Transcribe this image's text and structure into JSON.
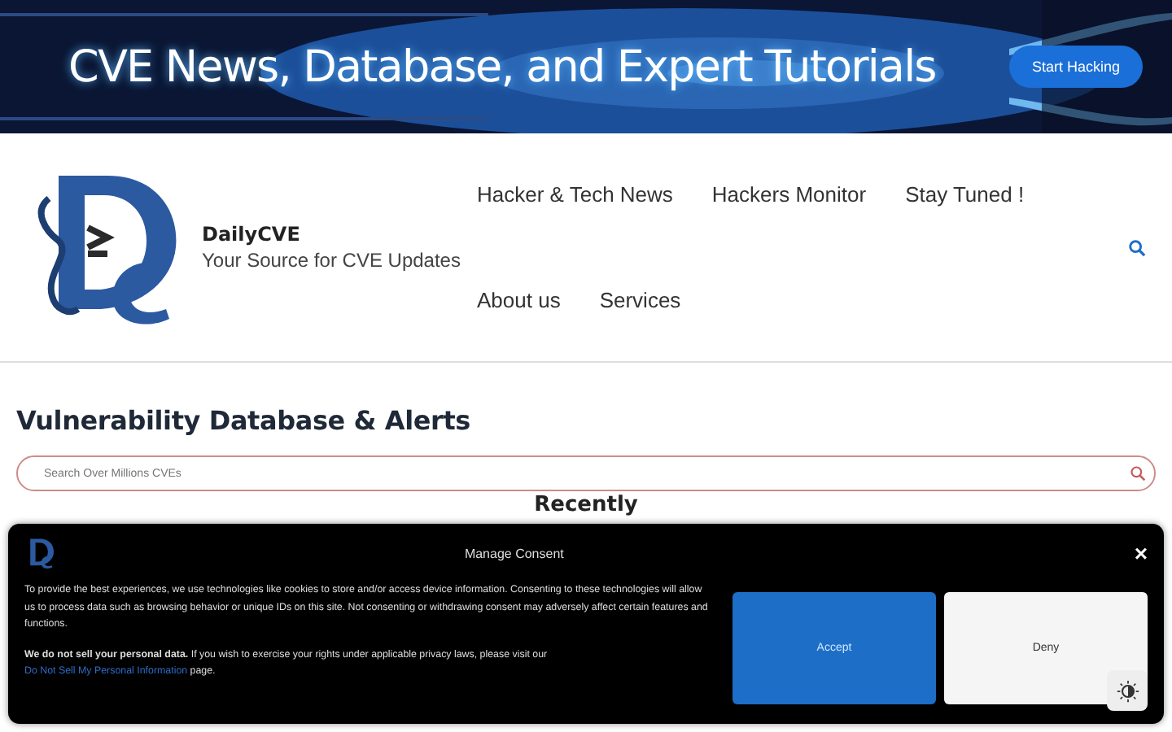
{
  "banner": {
    "title": "CVE News, Database, and Expert Tutorials",
    "button": "Start Hacking"
  },
  "site": {
    "name": "DailyCVE",
    "tagline": "Your Source for CVE Updates"
  },
  "nav": [
    {
      "label": "Hacker & Tech News"
    },
    {
      "label": "Hackers Monitor"
    },
    {
      "label": "Stay Tuned !"
    },
    {
      "label": "About us"
    },
    {
      "label": "Services"
    }
  ],
  "section": {
    "heading": "Vulnerability Database & Alerts",
    "search_placeholder": "Search Over Millions CVEs",
    "subheading": "Recently"
  },
  "consent": {
    "title": "Manage Consent",
    "close": "×",
    "message": "To provide the best experiences, we use technologies like cookies to store and/or access device information. Consenting to these technologies will allow us to process data such as browsing behavior or unique IDs on this site. Not consenting or withdrawing consent may adversely affect certain features and functions.",
    "privacy_lead": "**We do not sell your personal data.** If you wish to exercise your rights under applicable privacy laws, please visit our",
    "privacy_link": "Do Not Sell My Personal Information",
    "privacy_tail": "page.",
    "buttons": [
      {
        "label": "Accept",
        "kind": "primary"
      },
      {
        "label": "Deny",
        "kind": "secondary"
      }
    ]
  }
}
